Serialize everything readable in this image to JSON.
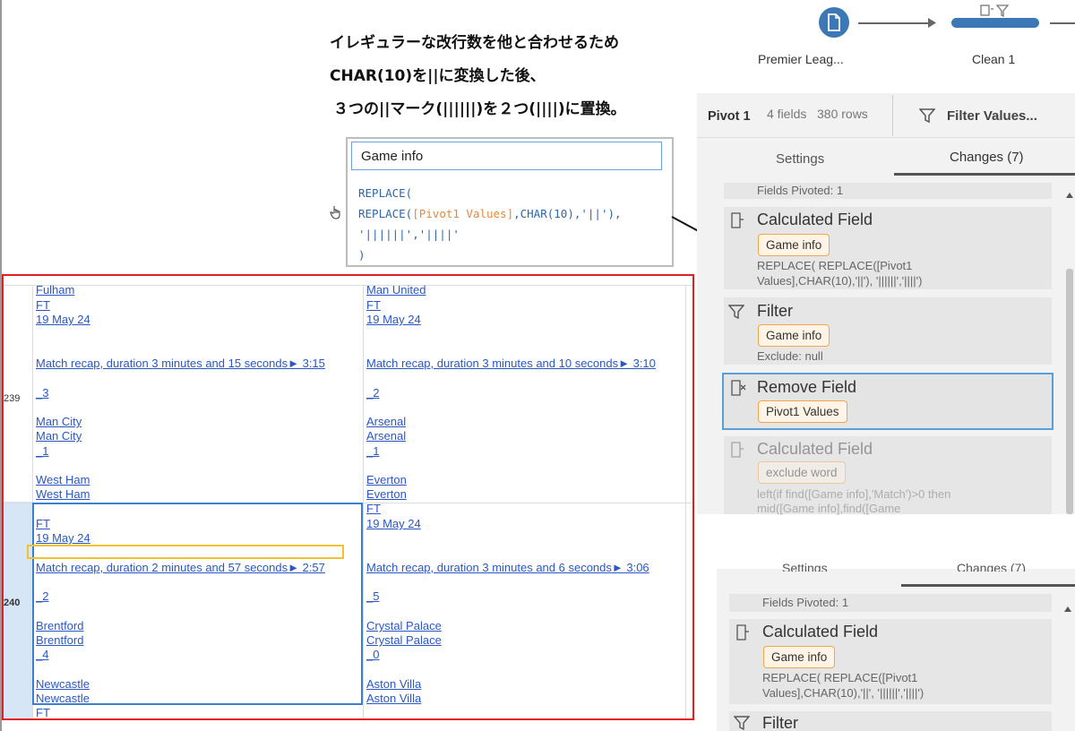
{
  "annotation": {
    "line1": "イレギュラーな改行数を他と合わせるため",
    "line2": "CHAR(10)を||に変換した後、",
    "line3": "３つの||マーク(||||||)を２つ(||||)に置換。"
  },
  "flow": {
    "step1_label": "Premier Leag...",
    "step2_label": "Clean 1"
  },
  "calc_editor": {
    "name": "Game info",
    "code_l1": "REPLACE(",
    "code_l2_fn": "REPLACE(",
    "code_l2_field": "[Pivot1 Values]",
    "code_l2_rest": ",CHAR(10),'||'),",
    "code_l3": "'||||||','||||'",
    "code_l4": ")"
  },
  "pivot_header": {
    "name": "Pivot 1",
    "fields": "4 fields",
    "rows": "380 rows",
    "filter_button": "Filter Values..."
  },
  "tabs": {
    "settings": "Settings",
    "changes": "Changes (7)"
  },
  "changes_top": {
    "fields_pivoted": "Fields Pivoted: 1",
    "calc1": {
      "title": "Calculated Field",
      "pill": "Game info",
      "formula1": "REPLACE( REPLACE([Pivot1",
      "formula2": "Values],CHAR(10),'||'), '||||||','||||')"
    },
    "filter": {
      "title": "Filter",
      "pill": "Game info",
      "detail": "Exclude: null"
    },
    "remove": {
      "title": "Remove Field",
      "pill": "Pivot1 Values"
    },
    "calc2": {
      "title": "Calculated Field",
      "pill": "exclude word",
      "formula1": "left(if find([Game info],'Match')>0 then",
      "formula2": "mid([Game info],find([Game"
    }
  },
  "changes_bottom": {
    "tab_settings": "Settings",
    "tab_changes": "Changes (7)",
    "fields_pivoted": "Fields Pivoted: 1",
    "calc1": {
      "title": "Calculated Field",
      "pill": "Game info",
      "formula1": "REPLACE( REPLACE([Pivot1",
      "formula2": "Values],CHAR(10),'||', '||||||','||||')"
    },
    "filter": {
      "title": "Filter"
    }
  },
  "grid": {
    "row239": {
      "num": "239",
      "col1": [
        "Fulham",
        "FT",
        "19 May 24",
        "Match recap, duration 3 minutes and 15 seconds► 3:15",
        "_3",
        "Man City",
        "Man City",
        "_1",
        "West Ham",
        "West Ham"
      ],
      "col2": [
        "Man United",
        "FT",
        "19 May 24",
        "Match recap, duration 3 minutes and 10 seconds► 3:10",
        "_2",
        "Arsenal",
        "Arsenal",
        "_1",
        "Everton",
        "Everton"
      ]
    },
    "row240": {
      "num": "240",
      "col1": [
        "FT",
        "19 May 24",
        "Match recap, duration 2 minutes and 57 seconds► 2:57",
        "_2",
        "Brentford",
        "Brentford",
        "_4",
        "Newcastle",
        "Newcastle",
        "FT"
      ],
      "col2": [
        "FT",
        "19 May 24",
        "Match recap, duration 3 minutes and 6 seconds► 3:06",
        "_5",
        "Crystal Palace",
        "Crystal Palace",
        "_0",
        "Aston Villa",
        "Aston Villa"
      ]
    }
  },
  "colors": {
    "accent_blue": "#3b78b5",
    "highlight_red": "#e02020",
    "highlight_yellow": "#f2c12e",
    "pill_orange": "#f0a64d",
    "link_blue": "#2a57c4"
  }
}
